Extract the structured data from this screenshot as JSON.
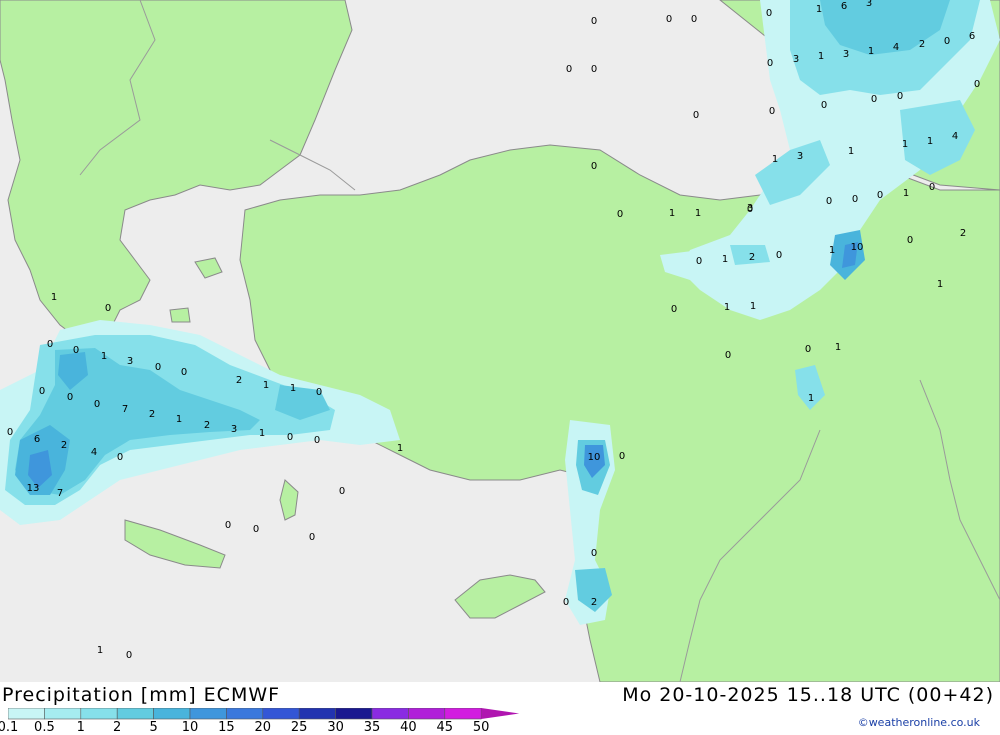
{
  "footer": {
    "title": "Precipitation [mm] ECMWF",
    "datetime": "Mo 20-10-2025 15..18 UTC (00+42)",
    "credit": "©weatheronline.co.uk"
  },
  "legend": {
    "labels": [
      "0.1",
      "0.5",
      "1",
      "2",
      "5",
      "10",
      "15",
      "20",
      "25",
      "30",
      "35",
      "40",
      "45",
      "50"
    ],
    "colors": [
      "#c8f5f5",
      "#a6ecf0",
      "#86e0ea",
      "#62cce0",
      "#49b4dc",
      "#3f96dc",
      "#3b78dc",
      "#3356d6",
      "#2233b0",
      "#1a1890",
      "#8a2be2",
      "#b01fd9",
      "#d21ce0",
      "#e019e0",
      "#b015b0"
    ]
  },
  "colors": {
    "sea": "#ededed",
    "land": "#b7f0a2",
    "border": "#9a9a9a",
    "coast": "#888888"
  },
  "precip_labels": [
    {
      "v": "0"
    },
    {
      "v": "0"
    },
    {
      "v": "0"
    },
    {
      "v": "0"
    },
    {
      "v": "1"
    },
    {
      "v": "6"
    },
    {
      "v": "3"
    },
    {
      "v": "0"
    },
    {
      "v": "0"
    },
    {
      "v": "0"
    },
    {
      "v": "0"
    },
    {
      "v": "3"
    },
    {
      "v": "1"
    },
    {
      "v": "3"
    },
    {
      "v": "1"
    },
    {
      "v": "4"
    },
    {
      "v": "2"
    },
    {
      "v": "0"
    },
    {
      "v": "6"
    },
    {
      "v": "0"
    },
    {
      "v": "0"
    },
    {
      "v": "0"
    },
    {
      "v": "0"
    },
    {
      "v": "0"
    },
    {
      "v": "1"
    },
    {
      "v": "1"
    },
    {
      "v": "4"
    },
    {
      "v": "1"
    },
    {
      "v": "3"
    },
    {
      "v": "1"
    },
    {
      "v": "0"
    },
    {
      "v": "0"
    },
    {
      "v": "1"
    },
    {
      "v": "1"
    },
    {
      "v": "0"
    },
    {
      "v": "3"
    },
    {
      "v": "0"
    },
    {
      "v": "0"
    },
    {
      "v": "0"
    },
    {
      "v": "2"
    },
    {
      "v": "1"
    },
    {
      "v": "10"
    },
    {
      "v": "1"
    },
    {
      "v": "0"
    },
    {
      "v": "2"
    },
    {
      "v": "0"
    },
    {
      "v": "1"
    },
    {
      "v": "0"
    },
    {
      "v": "1"
    },
    {
      "v": "1"
    },
    {
      "v": "0"
    },
    {
      "v": "0"
    },
    {
      "v": "1"
    },
    {
      "v": "1"
    },
    {
      "v": "0"
    },
    {
      "v": "0"
    },
    {
      "v": "0"
    },
    {
      "v": "1"
    },
    {
      "v": "3"
    },
    {
      "v": "0"
    },
    {
      "v": "0"
    },
    {
      "v": "1"
    },
    {
      "v": "2"
    },
    {
      "v": "1"
    },
    {
      "v": "1"
    },
    {
      "v": "0"
    },
    {
      "v": "0"
    },
    {
      "v": "0"
    },
    {
      "v": "7"
    },
    {
      "v": "2"
    },
    {
      "v": "1"
    },
    {
      "v": "2"
    },
    {
      "v": "3"
    },
    {
      "v": "1"
    },
    {
      "v": "0"
    },
    {
      "v": "0"
    },
    {
      "v": "1"
    },
    {
      "v": "0"
    },
    {
      "v": "6"
    },
    {
      "v": "2"
    },
    {
      "v": "4"
    },
    {
      "v": "0"
    },
    {
      "v": "13"
    },
    {
      "v": "7"
    },
    {
      "v": "0"
    },
    {
      "v": "0"
    },
    {
      "v": "0"
    },
    {
      "v": "0"
    },
    {
      "v": "0"
    },
    {
      "v": "0"
    },
    {
      "v": "1"
    },
    {
      "v": "0"
    },
    {
      "v": "10"
    },
    {
      "v": "0"
    },
    {
      "v": "0"
    },
    {
      "v": "0"
    },
    {
      "v": "2"
    },
    {
      "v": "1"
    },
    {
      "v": "0"
    }
  ]
}
